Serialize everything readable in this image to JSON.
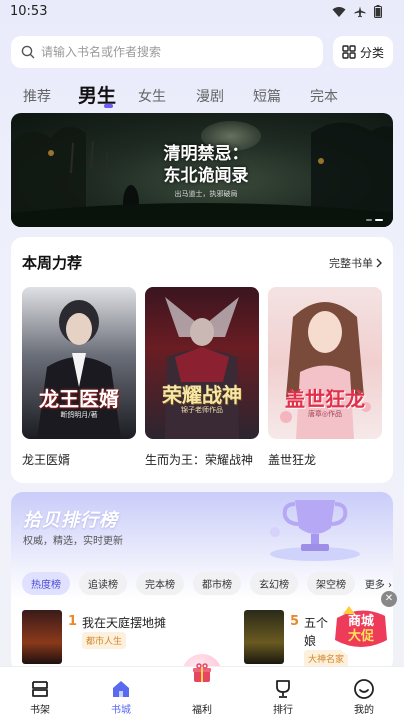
{
  "status_bar": {
    "time": "10:53"
  },
  "search": {
    "placeholder": "请输入书名或作者搜索",
    "category_label": "分类"
  },
  "tabs": [
    {
      "label": "推荐"
    },
    {
      "label": "男生"
    },
    {
      "label": "女生"
    },
    {
      "label": "漫剧"
    },
    {
      "label": "短篇"
    },
    {
      "label": "完本"
    }
  ],
  "banner": {
    "title_line1": "清明禁忌：",
    "title_line2": "东北诡闻录",
    "subtitle": "出马道士，执邪破局"
  },
  "weekly": {
    "title": "本周力荐",
    "more": "完整书单",
    "books": [
      {
        "name": "龙王医婿",
        "cover_text": "龙王医婿",
        "cover_author": "断鸽明月/著"
      },
      {
        "name": "生而为王：荣耀战神",
        "cover_text": "荣耀战神",
        "cover_author": "锦子老师作品"
      },
      {
        "name": "盖世狂龙",
        "cover_text": "盖世狂龙",
        "cover_author": "唐章◎作品"
      }
    ]
  },
  "ranking": {
    "title": "拾贝排行榜",
    "subtitle": "权威，精选，实时更新",
    "chips": [
      {
        "label": "热度榜"
      },
      {
        "label": "追读榜"
      },
      {
        "label": "完本榜"
      },
      {
        "label": "都市榜"
      },
      {
        "label": "玄幻榜"
      },
      {
        "label": "架空榜"
      }
    ],
    "more": "更多",
    "items": [
      {
        "rank": "1",
        "title": "我在天庭摆地摊",
        "tag": "都市人生"
      },
      {
        "rank": "5",
        "title": "五个",
        "title_line2": "娘",
        "tag": "大神名家"
      }
    ]
  },
  "promo": {
    "line1": "商城",
    "line2": "大促"
  },
  "bottom_nav": [
    {
      "label": "书架",
      "icon": "bookshelf-icon"
    },
    {
      "label": "书城",
      "icon": "home-icon"
    },
    {
      "label": "福利",
      "icon": "gift-icon"
    },
    {
      "label": "排行",
      "icon": "trophy-icon"
    },
    {
      "label": "我的",
      "icon": "profile-icon"
    }
  ],
  "colors": {
    "accent": "#5a6af0",
    "tag": "#d2862a",
    "rank_number": "#e9892a"
  }
}
